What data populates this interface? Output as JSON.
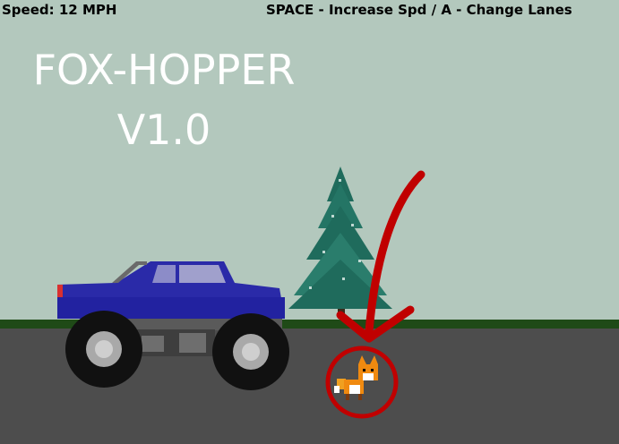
{
  "hud": {
    "speed": "Speed: 12 MPH",
    "controls": "SPACE - Increase Spd / A - Change Lanes"
  },
  "title": {
    "line1": "FOX-HOPPER",
    "line2": "V1.0"
  },
  "colors": {
    "sky": "#b3c8bd",
    "grass": "#1f4a17",
    "road": "#4d4d4d",
    "truck_body": "#2a2aa8",
    "highlight_red": "#c00000"
  },
  "sprites": {
    "truck": "monster-truck-sprite",
    "tree": "pine-tree-sprite",
    "fox": "fox-sprite",
    "arrow": "red-arrow-annotation",
    "circle": "red-circle-annotation"
  }
}
